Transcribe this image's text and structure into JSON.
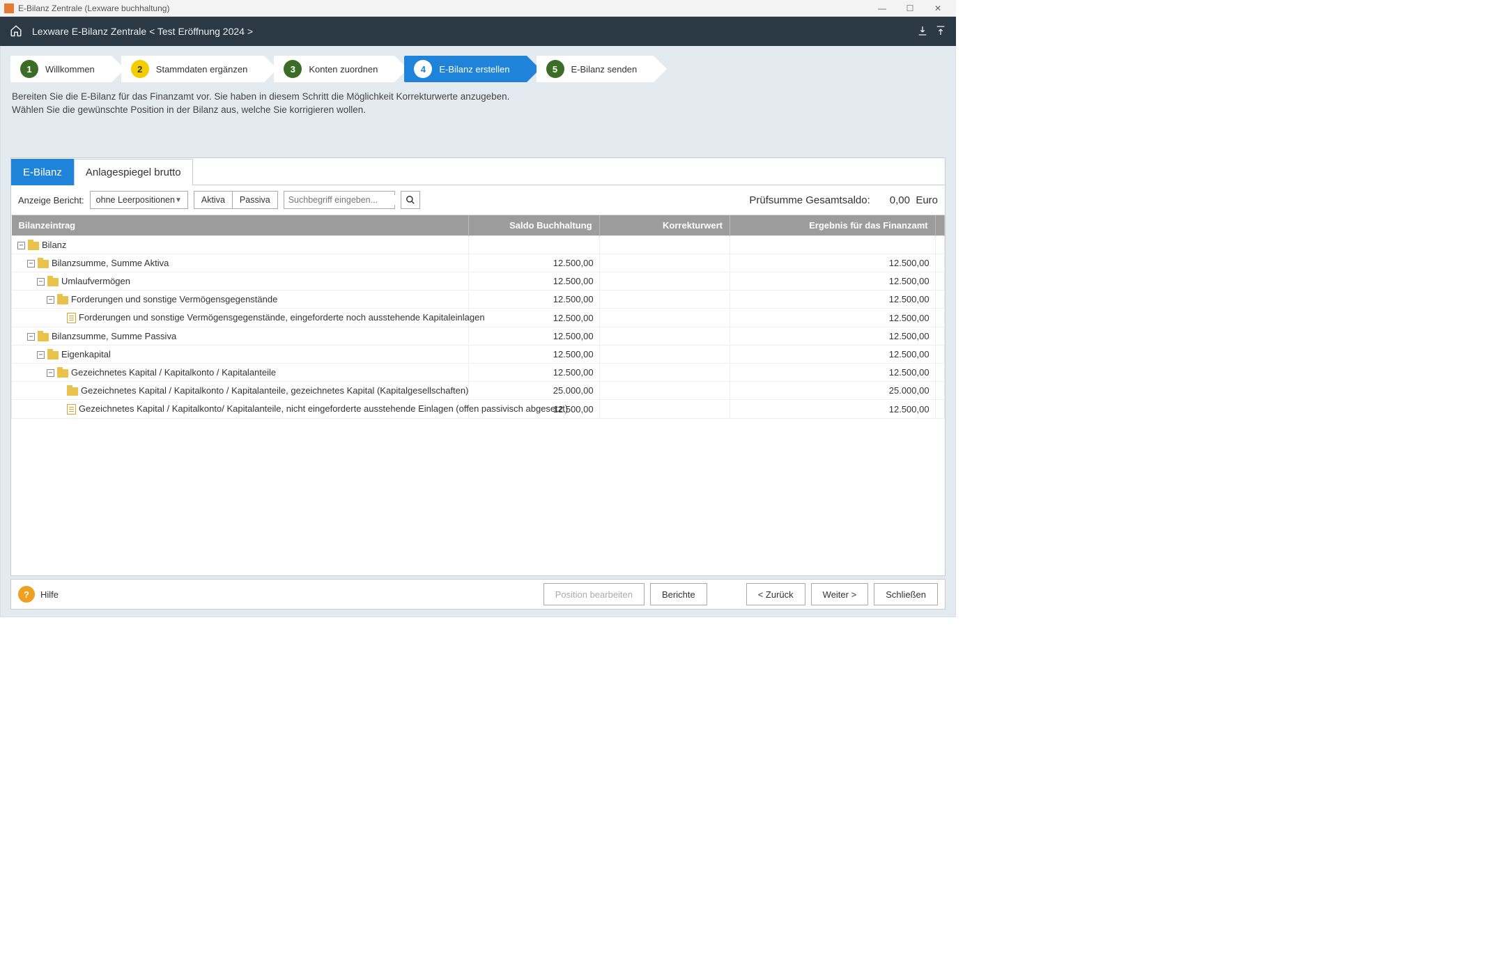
{
  "window": {
    "title": "E-Bilanz Zentrale (Lexware buchhaltung)"
  },
  "header": {
    "breadcrumb": "Lexware E-Bilanz Zentrale < Test Eröffnung 2024 >"
  },
  "steps": [
    {
      "num": "1",
      "label": "Willkommen",
      "color": "green",
      "active": false
    },
    {
      "num": "2",
      "label": "Stammdaten ergänzen",
      "color": "yellow",
      "active": false
    },
    {
      "num": "3",
      "label": "Konten zuordnen",
      "color": "green",
      "active": false
    },
    {
      "num": "4",
      "label": "E-Bilanz erstellen",
      "color": "active",
      "active": true
    },
    {
      "num": "5",
      "label": "E-Bilanz senden",
      "color": "green",
      "active": false
    }
  ],
  "instruction": {
    "line1": "Bereiten Sie die E-Bilanz für das Finanzamt vor. Sie haben in diesem Schritt die Möglichkeit Korrekturwerte anzugeben.",
    "line2": "Wählen Sie die gewünschte Position in der Bilanz aus, welche Sie korrigieren wollen."
  },
  "tabs": [
    {
      "label": "E-Bilanz",
      "active": true
    },
    {
      "label": "Anlagespiegel brutto",
      "active": false
    }
  ],
  "toolbar": {
    "report_label": "Anzeige Bericht:",
    "report_value": "ohne Leerpositionen",
    "aktiva": "Aktiva",
    "passiva": "Passiva",
    "search_placeholder": "Suchbegriff eingeben...",
    "pruef_label": "Prüfsumme Gesamtsaldo:",
    "pruef_value": "0,00",
    "currency": "Euro"
  },
  "table": {
    "headers": {
      "entry": "Bilanzeintrag",
      "saldo": "Saldo Buchhaltung",
      "korrektur": "Korrekturwert",
      "ergebnis": "Ergebnis für das Finanzamt"
    },
    "rows": [
      {
        "indent": 0,
        "icon": "folder",
        "collapse": true,
        "label": "Bilanz",
        "saldo": "",
        "korr": "",
        "erg": ""
      },
      {
        "indent": 1,
        "icon": "folder",
        "collapse": true,
        "label": "Bilanzsumme, Summe Aktiva",
        "saldo": "12.500,00",
        "korr": "",
        "erg": "12.500,00"
      },
      {
        "indent": 2,
        "icon": "folder",
        "collapse": true,
        "label": "Umlaufvermögen",
        "saldo": "12.500,00",
        "korr": "",
        "erg": "12.500,00"
      },
      {
        "indent": 3,
        "icon": "folder",
        "collapse": true,
        "label": "Forderungen und sonstige Vermögensgegenstände",
        "saldo": "12.500,00",
        "korr": "",
        "erg": "12.500,00"
      },
      {
        "indent": 4,
        "icon": "doc",
        "collapse": false,
        "label": "Forderungen und sonstige Vermögensgegenstände, eingeforderte noch ausstehende Kapitaleinlagen",
        "saldo": "12.500,00",
        "korr": "",
        "erg": "12.500,00"
      },
      {
        "indent": 1,
        "icon": "folder",
        "collapse": true,
        "label": "Bilanzsumme, Summe Passiva",
        "saldo": "12.500,00",
        "korr": "",
        "erg": "12.500,00"
      },
      {
        "indent": 2,
        "icon": "folder",
        "collapse": true,
        "label": "Eigenkapital",
        "saldo": "12.500,00",
        "korr": "",
        "erg": "12.500,00"
      },
      {
        "indent": 3,
        "icon": "folder",
        "collapse": true,
        "label": "Gezeichnetes Kapital / Kapitalkonto / Kapitalanteile",
        "saldo": "12.500,00",
        "korr": "",
        "erg": "12.500,00"
      },
      {
        "indent": 4,
        "icon": "folder",
        "collapse": false,
        "label": "Gezeichnetes Kapital / Kapitalkonto / Kapitalanteile, gezeichnetes Kapital (Kapitalgesellschaften)",
        "saldo": "25.000,00",
        "korr": "",
        "erg": "25.000,00"
      },
      {
        "indent": 4,
        "icon": "doc",
        "collapse": false,
        "label": "Gezeichnetes Kapital / Kapitalkonto/ Kapitalanteile, nicht eingeforderte ausstehende Einlagen (offen passivisch abgesetzt)",
        "saldo": "12.500,00",
        "korr": "",
        "erg": "12.500,00"
      }
    ]
  },
  "footer": {
    "help": "Hilfe",
    "edit": "Position bearbeiten",
    "reports": "Berichte",
    "back": "< Zurück",
    "next": "Weiter >",
    "close": "Schließen"
  }
}
